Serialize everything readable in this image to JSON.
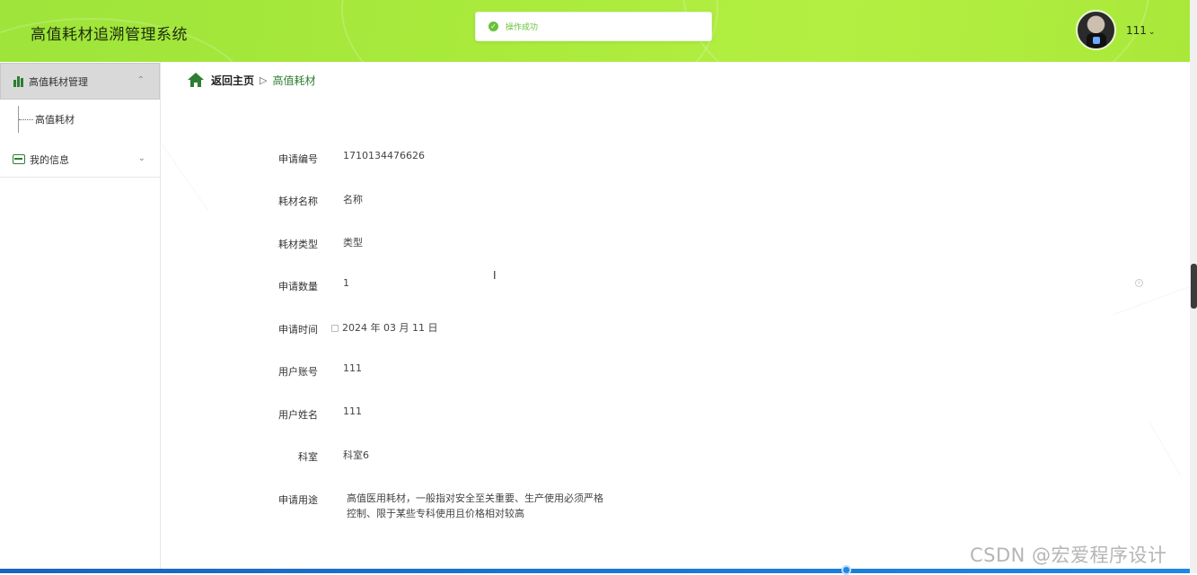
{
  "header": {
    "app_title": "高值耗材追溯管理系统",
    "toast_message": "操作成功",
    "user_name": "111",
    "user_menu_chevron": "⌄",
    "accent_color": "#a9ea3c"
  },
  "sidebar": {
    "groups": [
      {
        "label": "高值耗材管理",
        "icon": "bar-chart-icon",
        "expanded": true,
        "caret": "⌃",
        "items": [
          {
            "label": "高值耗材"
          }
        ]
      },
      {
        "label": "我的信息",
        "icon": "card-icon",
        "expanded": false,
        "caret": "⌄"
      }
    ]
  },
  "breadcrumb": {
    "home": "返回主页",
    "separator": "▷",
    "current": "高值耗材"
  },
  "form": {
    "fields": [
      {
        "label": "申请编号",
        "value": "1710134476626"
      },
      {
        "label": "耗材名称",
        "value": "名称"
      },
      {
        "label": "耗材类型",
        "value": "类型"
      },
      {
        "label": "申请数量",
        "value": "1"
      },
      {
        "label": "申请时间",
        "value": "2024 年 03 月 11 日"
      },
      {
        "label": "用户账号",
        "value": "111"
      },
      {
        "label": "用户姓名",
        "value": "111"
      },
      {
        "label": "科室",
        "value": "科室6"
      },
      {
        "label": "申请用途",
        "value_lines": [
          "高值医用耗材，一般指对安全至关重要、生产使用必须严格",
          "控制、限于某些专科使用且价格相对较高"
        ]
      }
    ]
  },
  "watermark": "CSDN @宏爱程序设计"
}
